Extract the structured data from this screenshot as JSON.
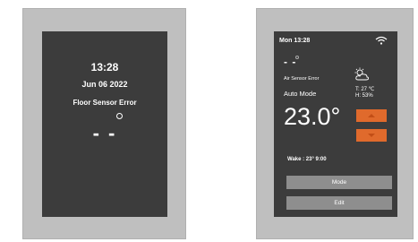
{
  "left_device": {
    "time": "13:28",
    "date": "Jun 06 2022",
    "error": "Floor Sensor Error",
    "temperature": "- -"
  },
  "right_device": {
    "clock": "Mon 13:28",
    "temperature_placeholder": "- -",
    "air_error": "Air Sensor Error",
    "mode": "Auto Mode",
    "setpoint": "23.0°",
    "temp_reading": "T:   27 ℃",
    "humidity_reading": "H:   53%",
    "wake": "Wake :     23°  9:00",
    "mode_button": "Mode",
    "edit_button": "Edit",
    "icons": [
      "wifi-icon",
      "partly-cloudy-icon",
      "up-arrow-icon",
      "down-arrow-icon"
    ]
  },
  "colors": {
    "frame": "#bfbfbf",
    "screen": "#3c3c3c",
    "accent_orange": "#e06a2c",
    "button_gray": "#8e8e8e"
  }
}
